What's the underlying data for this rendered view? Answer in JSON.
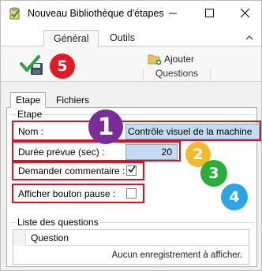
{
  "window": {
    "title": "Nouveau Bibliothèque d'étapes",
    "icons": {
      "app": "clipboard-check-icon",
      "minimize": "minimize-icon",
      "maximize": "maximize-icon",
      "close": "close-icon"
    }
  },
  "ribbon": {
    "tabs": [
      {
        "label": "Général",
        "active": true
      },
      {
        "label": "Outils",
        "active": false
      }
    ],
    "save_icon": "check-save-icon",
    "questions_group": {
      "add_label": "Ajouter",
      "group_label": "Questions",
      "add_icon": "folder-add-icon"
    }
  },
  "inner_tabs": [
    {
      "label": "Etape",
      "active": true
    },
    {
      "label": "Fichiers",
      "active": false
    }
  ],
  "etape": {
    "group_title": "Etape",
    "nom_label": "Nom :",
    "nom_value": "Contrôle visuel de la machine",
    "duree_label": "Durée prévue (sec) :",
    "duree_value": "20",
    "commentaire_label": "Demander commentaire :",
    "commentaire_checked": true,
    "pause_label": "Afficher bouton pause :",
    "pause_checked": false
  },
  "questions": {
    "group_title": "Liste des questions",
    "columns": [
      "Question"
    ],
    "empty_text": "Aucun enregistrement à afficher."
  },
  "annotations": {
    "badges": [
      "1",
      "2",
      "3",
      "4",
      "5"
    ],
    "colors": {
      "badge_1": "#7a2c98",
      "badge_2": "#f6b92a",
      "badge_3": "#2aad3a",
      "badge_4": "#29a5e8",
      "badge_5": "#e41a22",
      "highlight_box": "#e0101e"
    }
  },
  "colors": {
    "input_fill": "#c3dcf2",
    "window_bg": "#f0f0f0"
  }
}
